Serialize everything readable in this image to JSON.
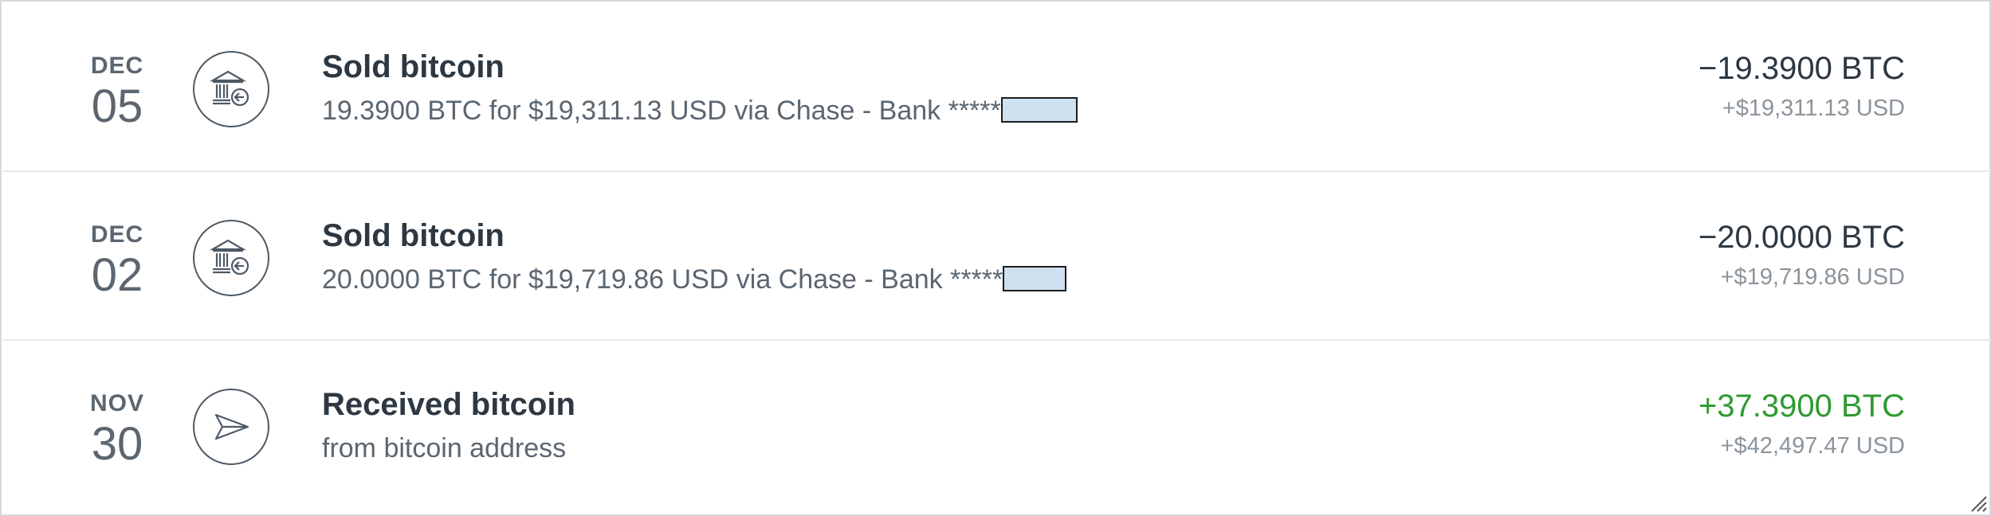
{
  "transactions": [
    {
      "month": "DEC",
      "day": "05",
      "icon": "bank-withdraw-icon",
      "title": "Sold bitcoin",
      "description": "19.3900 BTC for $19,311.13 USD via Chase - Bank *****",
      "redacted": true,
      "amount": "−19.3900 BTC",
      "amount_usd": "+$19,311.13 USD",
      "amount_color": "#2d3842"
    },
    {
      "month": "DEC",
      "day": "02",
      "icon": "bank-withdraw-icon",
      "title": "Sold bitcoin",
      "description": "20.0000 BTC for $19,719.86 USD via Chase - Bank *****",
      "redacted": true,
      "amount": "−20.0000 BTC",
      "amount_usd": "+$19,719.86 USD",
      "amount_color": "#2d3842"
    },
    {
      "month": "NOV",
      "day": "30",
      "icon": "paper-plane-icon",
      "title": "Received bitcoin",
      "description": "from bitcoin address",
      "redacted": false,
      "amount": "+37.3900 BTC",
      "amount_usd": "+$42,497.47 USD",
      "amount_color": "#2e9a30"
    }
  ]
}
